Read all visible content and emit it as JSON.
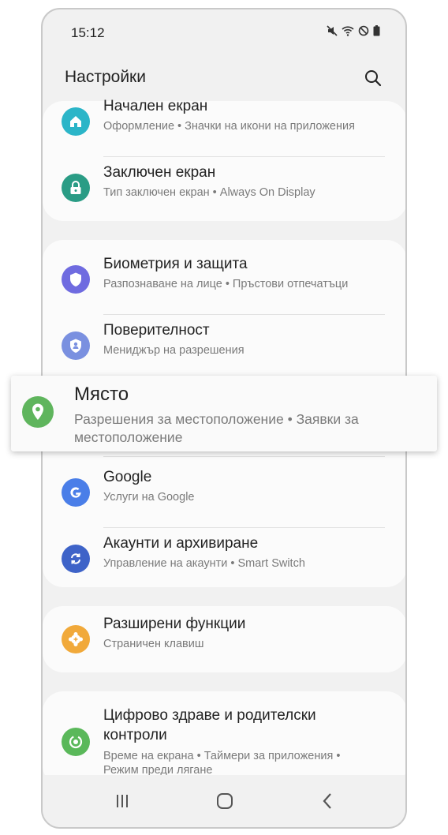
{
  "status_bar": {
    "time": "15:12",
    "icons": [
      "mute-icon",
      "wifi-icon",
      "do-not-disturb-icon",
      "battery-icon"
    ]
  },
  "header": {
    "title": "Настройки",
    "search_icon": "search-icon"
  },
  "groups": [
    {
      "items": [
        {
          "title": "Начален екран",
          "subtitle": "Оформление  •  Значки на икони на приложения",
          "icon": "home-icon",
          "color": "#2bb5c8"
        },
        {
          "title": "Заключен екран",
          "subtitle": "Тип заключен екран  •  Always On Display",
          "icon": "lock-icon",
          "color": "#2a9c85"
        }
      ]
    },
    {
      "items": [
        {
          "title": "Биометрия и защита",
          "subtitle": "Разпознаване на лице  •  Пръстови отпечатъци",
          "icon": "shield-icon",
          "color": "#6f6be0"
        },
        {
          "title": "Поверителност",
          "subtitle": "Мениджър на разрешения",
          "icon": "privacy-icon",
          "color": "#7a90e0"
        },
        {
          "title": "Google",
          "subtitle": "Услуги на Google",
          "icon": "google-icon",
          "color": "#4a7ee8"
        },
        {
          "title": "Акаунти и архивиране",
          "subtitle": "Управление на акаунти  •  Smart Switch",
          "icon": "sync-icon",
          "color": "#3e63c8"
        }
      ]
    },
    {
      "items": [
        {
          "title": "Разширени функции",
          "subtitle": "Страничен клавиш",
          "icon": "gear-plus-icon",
          "color": "#f1a93a"
        }
      ]
    },
    {
      "items": [
        {
          "title": "Цифрово здраве и родителски контроли",
          "title_line1": "Цифрово здраве и родителски",
          "title_line2": "контроли",
          "subtitle_line1": "Време на екрана  •  Таймери за приложения  •",
          "subtitle_line2": "Режим преди лягане",
          "icon": "digital-wellbeing-icon",
          "color": "#5ab85a"
        }
      ]
    }
  ],
  "highlight": {
    "title": "Място",
    "subtitle": "Разрешения за местоположение  •  Заявки за местоположение",
    "icon": "location-pin-icon",
    "color": "#5fb55d"
  },
  "nav_bar": {
    "recents_icon": "recents-icon",
    "home_icon": "home-button-icon",
    "back_icon": "back-icon"
  }
}
